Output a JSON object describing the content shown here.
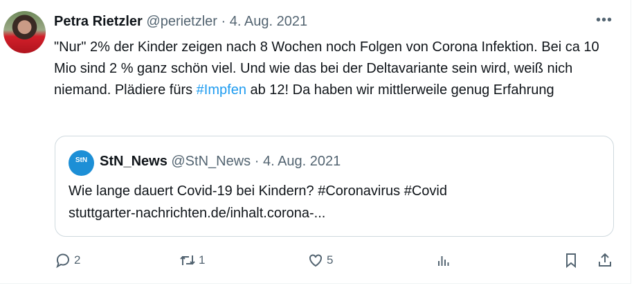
{
  "tweet": {
    "author_name": "Petra Rietzler",
    "handle": "@perietzler",
    "separator": "·",
    "date": "4. Aug. 2021",
    "more_label": "•••",
    "text_before": "\"Nur\" 2% der Kinder zeigen nach 8 Wochen noch Folgen von Corona Infektion.  Bei ca 10 Mio sind 2 % ganz schön viel. Und wie das bei der Deltavariante sein wird, weiß nich niemand. Plädiere fürs ",
    "hashtag": "#Impfen",
    "text_after": " ab 12! Da haben wir mittlerweile genug Erfahrung"
  },
  "quote": {
    "avatar_text": "StN",
    "author_name": "StN_News",
    "handle": "@StN_News",
    "separator": "·",
    "date": "4. Aug. 2021",
    "line1": "Wie lange dauert Covid-19 bei Kindern? #Coronavirus #Covid",
    "line2": "stuttgarter-nachrichten.de/inhalt.corona-..."
  },
  "actions": {
    "replies": "2",
    "retweets": "1",
    "likes": "5"
  },
  "colors": {
    "link": "#1d9bf0",
    "muted": "#536471",
    "text": "#0f1419"
  }
}
